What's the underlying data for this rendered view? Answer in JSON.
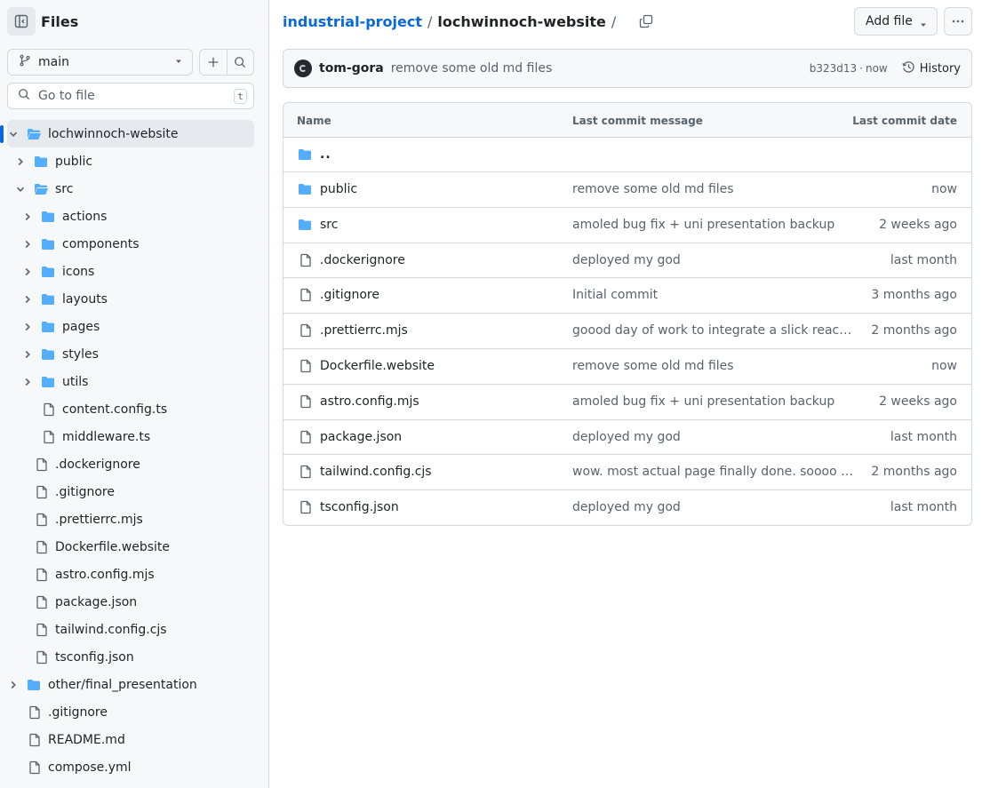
{
  "colors": {
    "accent": "#0969da",
    "folder": "#54aeff",
    "muted": "#59636e",
    "border": "#d1d9e0"
  },
  "sidebar": {
    "title": "Files",
    "branch": "main",
    "search_placeholder": "Go to file",
    "search_shortcut": "t",
    "tree": [
      {
        "label": "lochwinnoch-website",
        "type": "folder-open",
        "depth": 0,
        "expanded": true,
        "active": true
      },
      {
        "label": "public",
        "type": "folder",
        "depth": 1,
        "expanded": false
      },
      {
        "label": "src",
        "type": "folder-open",
        "depth": 1,
        "expanded": true
      },
      {
        "label": "actions",
        "type": "folder",
        "depth": 2,
        "expanded": false
      },
      {
        "label": "components",
        "type": "folder",
        "depth": 2,
        "expanded": false
      },
      {
        "label": "icons",
        "type": "folder",
        "depth": 2,
        "expanded": false
      },
      {
        "label": "layouts",
        "type": "folder",
        "depth": 2,
        "expanded": false
      },
      {
        "label": "pages",
        "type": "folder",
        "depth": 2,
        "expanded": false
      },
      {
        "label": "styles",
        "type": "folder",
        "depth": 2,
        "expanded": false
      },
      {
        "label": "utils",
        "type": "folder",
        "depth": 2,
        "expanded": false
      },
      {
        "label": "content.config.ts",
        "type": "file",
        "depth": 2
      },
      {
        "label": "middleware.ts",
        "type": "file",
        "depth": 2
      },
      {
        "label": ".dockerignore",
        "type": "file",
        "depth": 1
      },
      {
        "label": ".gitignore",
        "type": "file",
        "depth": 1
      },
      {
        "label": ".prettierrc.mjs",
        "type": "file",
        "depth": 1
      },
      {
        "label": "Dockerfile.website",
        "type": "file",
        "depth": 1
      },
      {
        "label": "astro.config.mjs",
        "type": "file",
        "depth": 1
      },
      {
        "label": "package.json",
        "type": "file",
        "depth": 1
      },
      {
        "label": "tailwind.config.cjs",
        "type": "file",
        "depth": 1
      },
      {
        "label": "tsconfig.json",
        "type": "file",
        "depth": 1
      },
      {
        "label": "other/final_presentation",
        "type": "folder",
        "depth": 0,
        "expanded": false
      },
      {
        "label": ".gitignore",
        "type": "file",
        "depth": 0
      },
      {
        "label": "README.md",
        "type": "file",
        "depth": 0
      },
      {
        "label": "compose.yml",
        "type": "file",
        "depth": 0
      }
    ]
  },
  "header": {
    "repo": "industrial-project",
    "separator": "/",
    "current_dir": "lochwinnoch-website",
    "trailing_separator": "/",
    "add_file_label": "Add file"
  },
  "commit": {
    "author": "tom-gora",
    "message": "remove some old md files",
    "hash": "b323d13",
    "dot": "·",
    "time": "now",
    "history_label": "History"
  },
  "table": {
    "columns": {
      "name": "Name",
      "message": "Last commit message",
      "date": "Last commit date"
    },
    "parent_label": "..",
    "rows": [
      {
        "name": "public",
        "type": "folder",
        "message": "remove some old md files",
        "date": "now"
      },
      {
        "name": "src",
        "type": "folder",
        "message": "amoled bug fix + uni presentation backup",
        "date": "2 weeks ago"
      },
      {
        "name": ".dockerignore",
        "type": "file",
        "message": "deployed my god",
        "date": "last month"
      },
      {
        "name": ".gitignore",
        "type": "file",
        "message": "Initial commit",
        "date": "3 months ago"
      },
      {
        "name": ".prettierrc.mjs",
        "type": "file",
        "message": "goood day of work to integrate a slick react newsletter component",
        "date": "2 months ago"
      },
      {
        "name": "Dockerfile.website",
        "type": "file",
        "message": "remove some old md files",
        "date": "now"
      },
      {
        "name": "astro.config.mjs",
        "type": "file",
        "message": "amoled bug fix + uni presentation backup",
        "date": "2 weeks ago"
      },
      {
        "name": "package.json",
        "type": "file",
        "message": "deployed my god",
        "date": "last month"
      },
      {
        "name": "tailwind.config.cjs",
        "type": "file",
        "message": "wow. most actual page finally done. soooo much work",
        "date": "2 months ago"
      },
      {
        "name": "tsconfig.json",
        "type": "file",
        "message": "deployed my god",
        "date": "last month"
      }
    ]
  }
}
